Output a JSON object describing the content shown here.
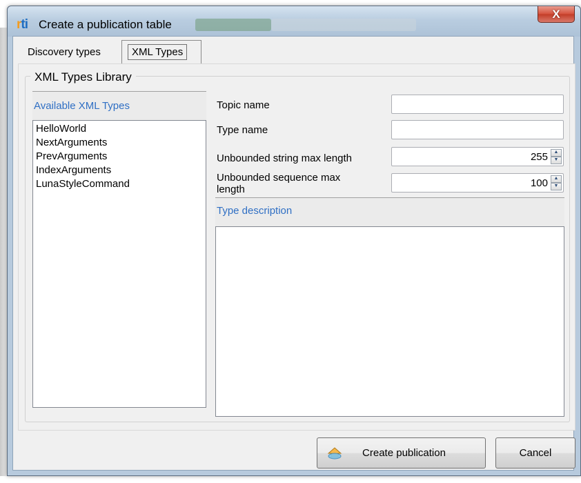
{
  "window": {
    "title": "Create a publication table",
    "logo": "rti",
    "close_label": "X"
  },
  "tabs": [
    {
      "label": "Discovery types",
      "active": false
    },
    {
      "label": "XML Types",
      "active": true
    }
  ],
  "library": {
    "group_label": "XML Types Library",
    "available_header": "Available XML Types",
    "types": [
      "HelloWorld",
      "NextArguments",
      "PrevArguments",
      "IndexArguments",
      "LunaStyleCommand"
    ]
  },
  "form": {
    "topic_name_label": "Topic name",
    "topic_name_value": "",
    "type_name_label": "Type name",
    "type_name_value": "",
    "string_max_label": "Unbounded string max length",
    "string_max_value": "255",
    "sequence_max_label_line1": "Unbounded sequence max",
    "sequence_max_label_line2": "length",
    "sequence_max_value": "100",
    "type_description_header": "Type description"
  },
  "buttons": {
    "create_label": "Create publication",
    "cancel_label": "Cancel"
  },
  "icons": {
    "app": "rti-logo-icon",
    "publish": "publish-icon",
    "spin_up": "spin-up-icon",
    "spin_down": "spin-down-icon"
  },
  "colors": {
    "accent_text": "#2f6fc4",
    "close_button": "#c33d27",
    "titlebar": "#b9cde0"
  }
}
